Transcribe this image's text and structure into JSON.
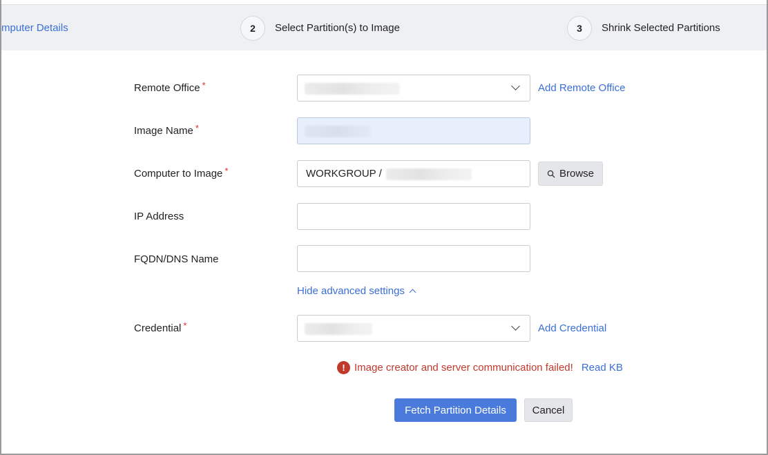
{
  "stepper": {
    "steps": [
      {
        "number": "",
        "label": "mputer Details",
        "state": "completed"
      },
      {
        "number": "2",
        "label": "Select Partition(s) to Image",
        "state": "current"
      },
      {
        "number": "3",
        "label": "Shrink Selected Partitions",
        "state": "upcoming"
      }
    ]
  },
  "form": {
    "remote_office": {
      "label": "Remote Office",
      "required": "*",
      "value": "",
      "add_link": "Add Remote Office"
    },
    "image_name": {
      "label": "Image Name",
      "required": "*",
      "value": ""
    },
    "computer_to_image": {
      "label": "Computer to Image",
      "required": "*",
      "value": "WORKGROUP /",
      "browse_label": "Browse"
    },
    "ip_address": {
      "label": "IP Address",
      "value": ""
    },
    "fqdn": {
      "label": "FQDN/DNS Name",
      "value": ""
    },
    "advanced_toggle": "Hide advanced settings",
    "credential": {
      "label": "Credential",
      "required": "*",
      "value": "",
      "add_link": "Add Credential"
    }
  },
  "error": {
    "icon": "!",
    "message": "Image creator and server communication failed!",
    "link": "Read KB"
  },
  "actions": {
    "primary": "Fetch Partition Details",
    "secondary": "Cancel"
  },
  "colors": {
    "accent": "#3a6fd8",
    "error": "#c0392b",
    "primary_button": "#4a7bdc",
    "required": "#d93025"
  }
}
